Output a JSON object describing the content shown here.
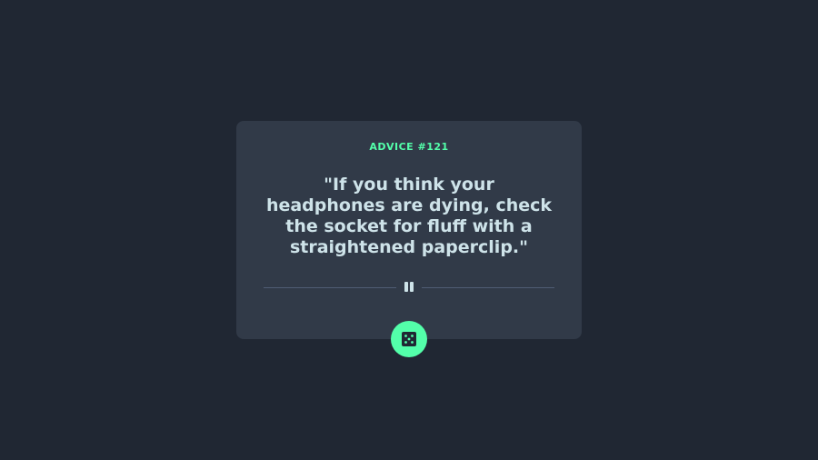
{
  "card": {
    "advice_label": "ADVICE #121",
    "quote": "\"If you think your headphones are dying, check the socket for fluff with a straightened paperclip.\""
  },
  "icons": {
    "divider": "pause-icon",
    "button": "dice-icon"
  },
  "colors": {
    "background": "#202733",
    "card": "#313a48",
    "accent": "#53ffaa",
    "text": "#cee3e9",
    "divider": "#4f5d74"
  }
}
